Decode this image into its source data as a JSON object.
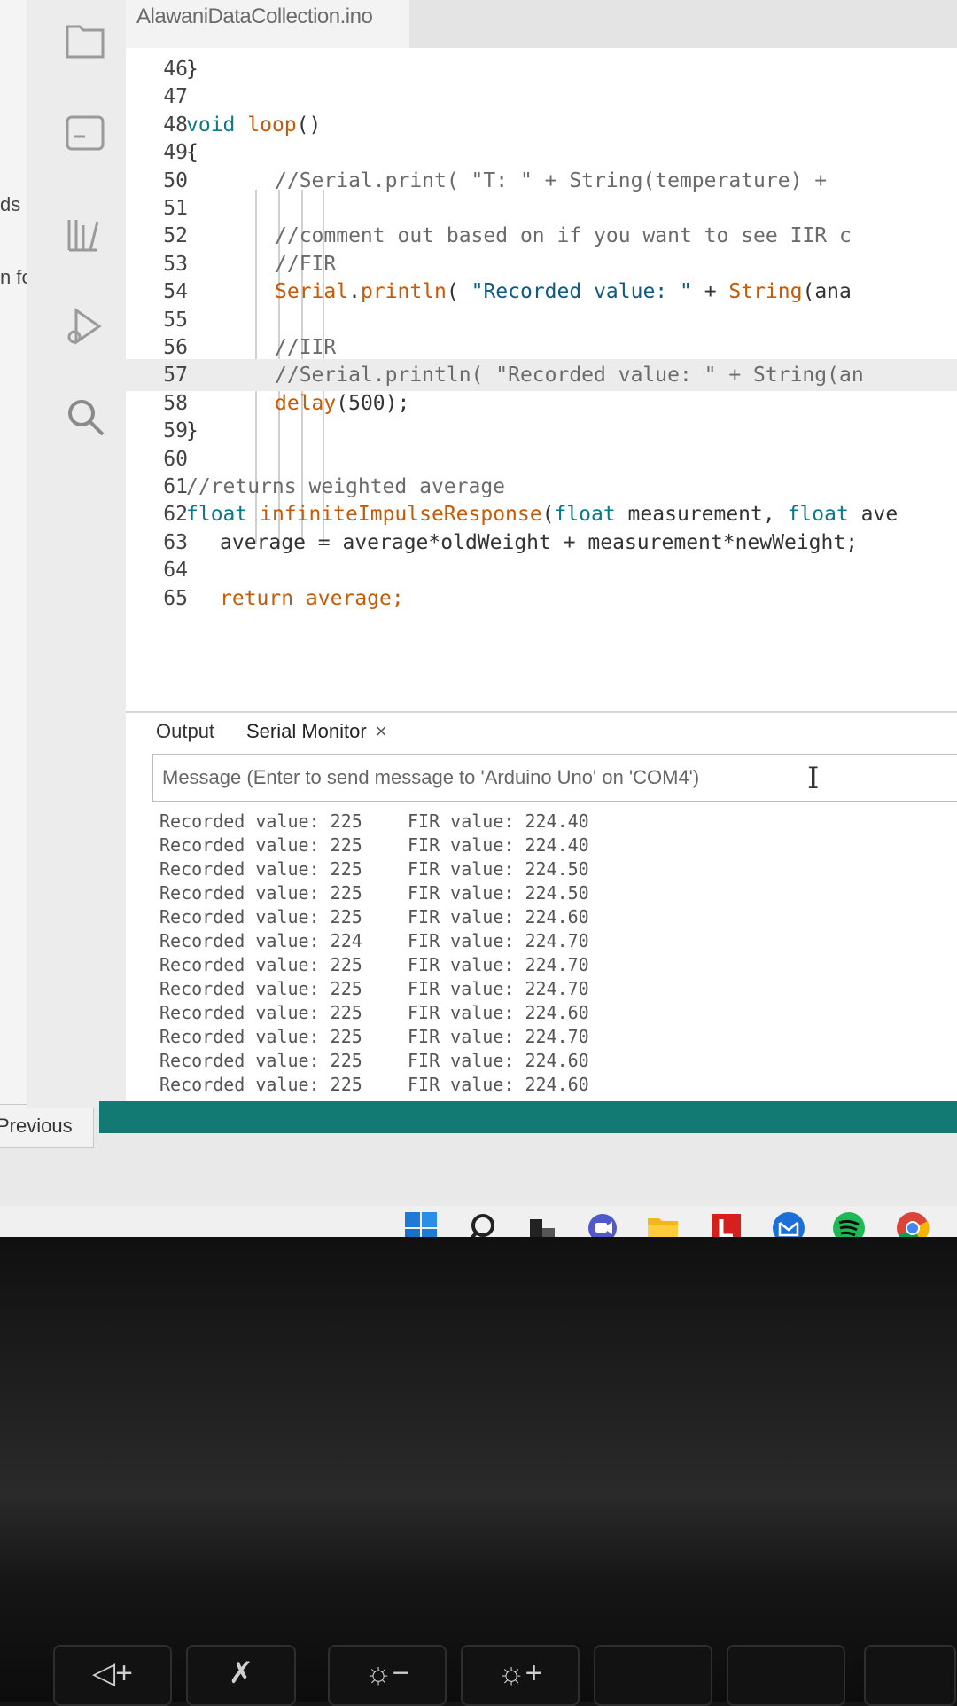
{
  "window": {
    "file_tab": "AlawaniDataCollection.ino"
  },
  "browser_fragments": [
    {
      "text": "ds",
      "top": 0
    },
    {
      "text": "n fc",
      "top": 0
    }
  ],
  "previous_label": "Previous",
  "code_lines": [
    {
      "n": "46",
      "tokens": [
        [
          "}",
          "c-text"
        ]
      ],
      "indent": 0
    },
    {
      "n": "47",
      "tokens": [],
      "indent": 0
    },
    {
      "n": "48",
      "tokens": [
        [
          "void ",
          "c-kw"
        ],
        [
          "loop",
          "c-fn"
        ],
        [
          "()",
          "c-text"
        ]
      ],
      "indent": 0
    },
    {
      "n": "49",
      "tokens": [
        [
          "{",
          "c-text"
        ]
      ],
      "indent": 0
    },
    {
      "n": "50",
      "tokens": [
        [
          "//Serial.print( \"T: \" + String(temperature) +",
          "c-comment"
        ]
      ],
      "indent": 1
    },
    {
      "n": "51",
      "tokens": [],
      "indent": 1
    },
    {
      "n": "52",
      "tokens": [
        [
          "//comment out based on if you want to see IIR c",
          "c-comment"
        ]
      ],
      "indent": 1
    },
    {
      "n": "53",
      "tokens": [
        [
          "//FIR",
          "c-comment"
        ]
      ],
      "indent": 1
    },
    {
      "n": "54",
      "tokens": [
        [
          "Serial",
          "c-fn"
        ],
        [
          ".",
          "c-text"
        ],
        [
          "println",
          "c-fn"
        ],
        [
          "( ",
          "c-text"
        ],
        [
          "\"Recorded value: \"",
          "c-str"
        ],
        [
          " + ",
          "c-text"
        ],
        [
          "String",
          "c-fn"
        ],
        [
          "(ana",
          "c-text"
        ]
      ],
      "indent": 1
    },
    {
      "n": "55",
      "tokens": [],
      "indent": 1
    },
    {
      "n": "56",
      "tokens": [
        [
          "//IIR",
          "c-comment"
        ]
      ],
      "indent": 1
    },
    {
      "n": "57",
      "tokens": [
        [
          "//Serial.println( \"Recorded value: \" + String(an",
          "c-comment"
        ]
      ],
      "indent": 1,
      "highlight": true
    },
    {
      "n": "58",
      "tokens": [
        [
          "delay",
          "c-fn"
        ],
        [
          "(500);",
          "c-text"
        ]
      ],
      "indent": 1
    },
    {
      "n": "59",
      "tokens": [
        [
          "}",
          "c-text"
        ]
      ],
      "indent": 0
    },
    {
      "n": "60",
      "tokens": [],
      "indent": 0
    },
    {
      "n": "61",
      "tokens": [
        [
          "//returns weighted average",
          "c-comment"
        ]
      ],
      "indent": 0
    },
    {
      "n": "62",
      "tokens": [
        [
          "float ",
          "c-kw"
        ],
        [
          "infiniteImpulseResponse",
          "c-fn"
        ],
        [
          "(",
          "c-text"
        ],
        [
          "float",
          "c-kw"
        ],
        [
          " measurement, ",
          "c-text"
        ],
        [
          "float",
          "c-kw"
        ],
        [
          " ave",
          "c-text"
        ]
      ],
      "indent": 0
    },
    {
      "n": "63",
      "tokens": [
        [
          "average = average*oldWeight + measurement*newWeight;",
          "c-text"
        ]
      ],
      "indent": 2
    },
    {
      "n": "64",
      "tokens": [],
      "indent": 0
    },
    {
      "n": "65",
      "tokens": [
        [
          "return average;",
          "c-fn"
        ]
      ],
      "indent": 2
    }
  ],
  "panel": {
    "tab_output": "Output",
    "tab_serial": "Serial Monitor",
    "close_symbol": "×",
    "message_placeholder": "Message (Enter to send message to 'Arduino Uno' on 'COM4')"
  },
  "serial_output": [
    {
      "recorded": "Recorded value: 225",
      "fir": "FIR value: 224.40"
    },
    {
      "recorded": "Recorded value: 225",
      "fir": "FIR value: 224.40"
    },
    {
      "recorded": "Recorded value: 225",
      "fir": "FIR value: 224.50"
    },
    {
      "recorded": "Recorded value: 225",
      "fir": "FIR value: 224.50"
    },
    {
      "recorded": "Recorded value: 225",
      "fir": "FIR value: 224.60"
    },
    {
      "recorded": "Recorded value: 224",
      "fir": "FIR value: 224.70"
    },
    {
      "recorded": "Recorded value: 225",
      "fir": "FIR value: 224.70"
    },
    {
      "recorded": "Recorded value: 225",
      "fir": "FIR value: 224.70"
    },
    {
      "recorded": "Recorded value: 225",
      "fir": "FIR value: 224.60"
    },
    {
      "recorded": "Recorded value: 225",
      "fir": "FIR value: 224.70"
    },
    {
      "recorded": "Recorded value: 225",
      "fir": "FIR value: 224.60"
    },
    {
      "recorded": "Recorded value: 225",
      "fir": "FIR value: 224.60"
    }
  ],
  "taskbar_icons": [
    "windows-start-icon",
    "search-icon",
    "task-view-icon",
    "teams-chat-icon",
    "file-explorer-icon",
    "app-l-icon",
    "mail-icon",
    "spotify-icon",
    "chrome-icon"
  ],
  "colors": {
    "status_bar": "#127a73",
    "keyword": "#0a7a86",
    "function": "#c75a07"
  }
}
